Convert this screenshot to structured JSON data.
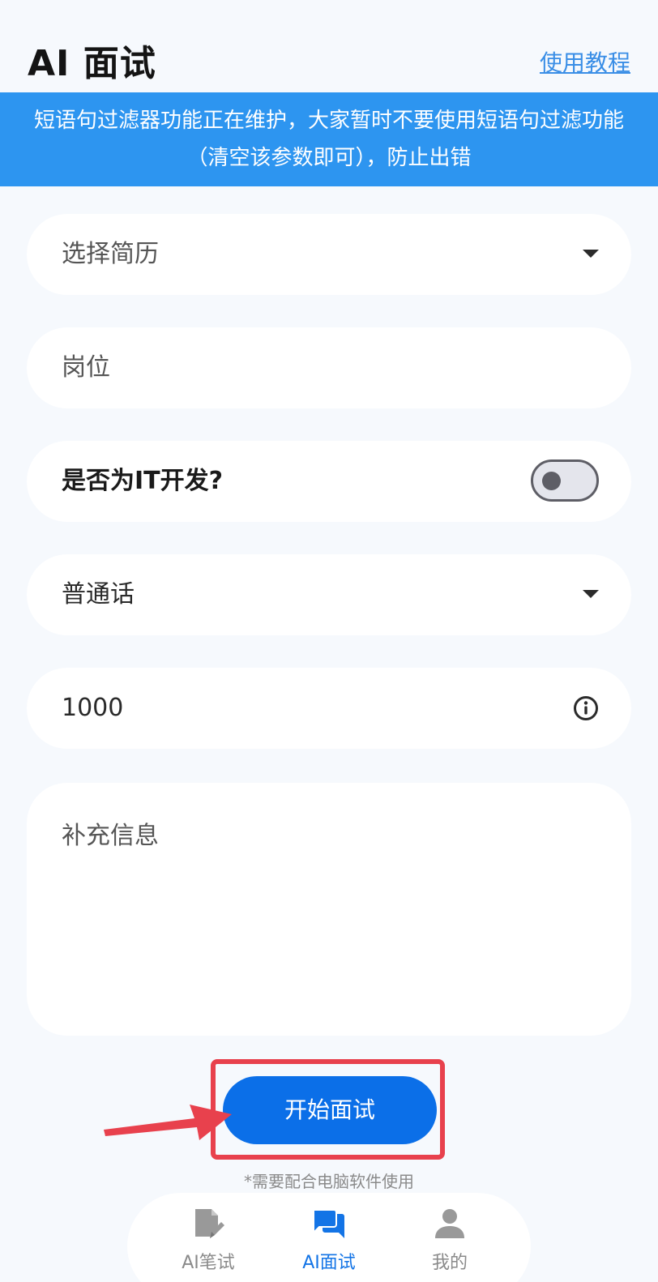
{
  "header": {
    "title": "AI 面试",
    "tutorial_link": "使用教程"
  },
  "notice": {
    "text": "短语句过滤器功能正在维护，大家暂时不要使用短语句过滤功能（清空该参数即可），防止出错"
  },
  "form": {
    "resume_select": {
      "value": "选择简历",
      "icon": "chevron-down-icon"
    },
    "position_input": {
      "placeholder": "岗位"
    },
    "it_dev_toggle": {
      "label": "是否为IT开发?",
      "checked": false
    },
    "language_select": {
      "value": "普通话",
      "icon": "chevron-down-icon"
    },
    "number_input": {
      "value": "1000",
      "icon": "info-icon"
    },
    "extra_info": {
      "placeholder": "补充信息"
    }
  },
  "actions": {
    "start_button": "开始面试",
    "hint": "*需要配合电脑软件使用"
  },
  "tabbar": {
    "items": [
      {
        "label": "AI笔试",
        "icon": "note-edit-icon",
        "active": false
      },
      {
        "label": "AI面试",
        "icon": "chat-bubbles-icon",
        "active": true
      },
      {
        "label": "我的",
        "icon": "person-icon",
        "active": false
      }
    ]
  },
  "colors": {
    "accent": "#0b6fe8",
    "notice_bg": "#2d95f0",
    "highlight": "#e8414d",
    "background": "#f6f9fd"
  }
}
